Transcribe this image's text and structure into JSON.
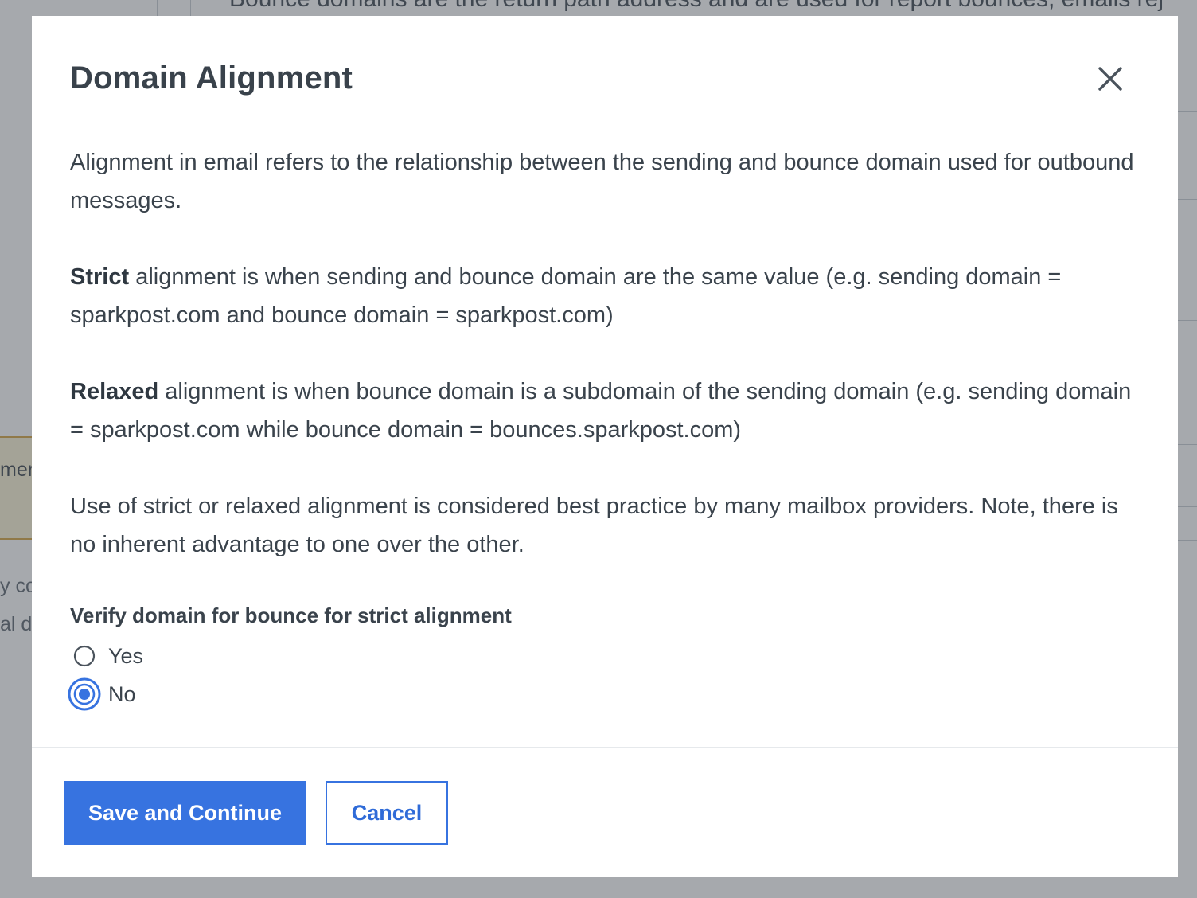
{
  "background": {
    "top_text": "Bounce domains are the return path address and are used for report bounces, emails rej",
    "fragment_banner": "mer",
    "fragment_line1": "y co",
    "fragment_line2": "al d"
  },
  "modal": {
    "title": "Domain Alignment",
    "close_icon": "close-icon",
    "intro": "Alignment in email refers to the relationship between the sending and bounce domain used for outbound messages.",
    "strict": {
      "term": "Strict",
      "text": " alignment is when sending and bounce domain are the same value (e.g. sending domain = sparkpost.com and bounce domain = sparkpost.com)"
    },
    "relaxed": {
      "term": "Relaxed",
      "text": " alignment is when bounce domain is a subdomain of the sending domain (e.g. sending domain = sparkpost.com while bounce domain = bounces.sparkpost.com)"
    },
    "note": "Use of strict or relaxed alignment is considered best practice by many mailbox providers. Note, there is no inherent advantage to one over the other.",
    "radio_group": {
      "legend": "Verify domain for bounce for strict alignment",
      "options": [
        {
          "label": "Yes",
          "selected": false
        },
        {
          "label": "No",
          "selected": true
        }
      ]
    },
    "buttons": {
      "save_label": "Save and Continue",
      "cancel_label": "Cancel"
    }
  },
  "colors": {
    "primary": "#3773e0",
    "text": "#3a434c",
    "overlay": "#a6a9ac"
  }
}
